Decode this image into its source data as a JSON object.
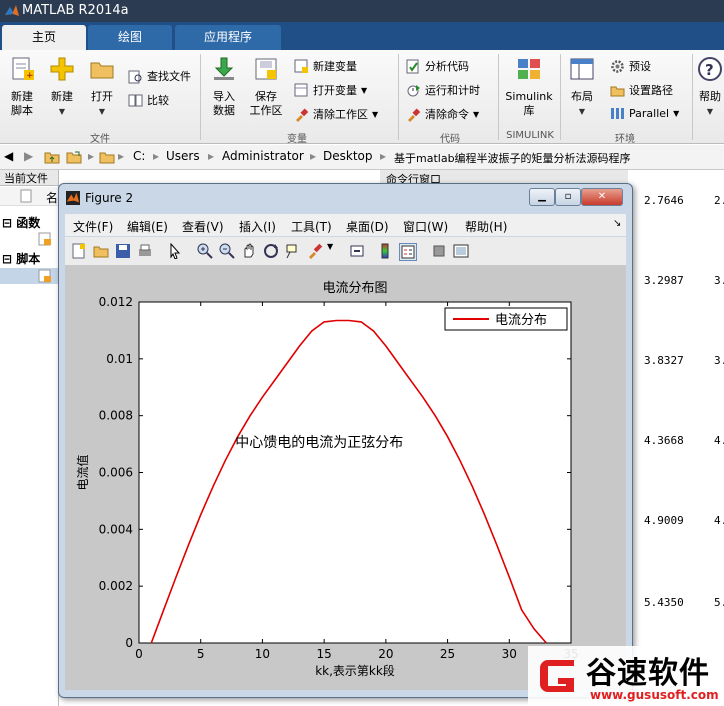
{
  "app": {
    "title": "MATLAB R2014a"
  },
  "tabs": [
    {
      "label": "主页"
    },
    {
      "label": "绘图"
    },
    {
      "label": "应用程序"
    }
  ],
  "ribbon": {
    "file": {
      "new_script": "新建\n脚本",
      "new": "新建",
      "open": "打开",
      "find_files": "查找文件",
      "compare": "比较",
      "group": "文件"
    },
    "variable": {
      "import": "导入\n数据",
      "save": "保存\n工作区",
      "new_var": "新建变量",
      "open_var": "打开变量",
      "clear_ws": "清除工作区",
      "group": "变量"
    },
    "code": {
      "analyze": "分析代码",
      "run_time": "运行和计时",
      "clear_cmd": "清除命令",
      "group": "代码"
    },
    "simulink": {
      "library": "Simulink\n库",
      "group": "SIMULINK"
    },
    "env": {
      "layout": "布局",
      "prefs": "预设",
      "set_path": "设置路径",
      "parallel": "Parallel",
      "group": "环境"
    },
    "help": {
      "label": "帮助"
    }
  },
  "address": {
    "parts": [
      "C:",
      "Users",
      "Administrator",
      "Desktop",
      "基于matlab编程半波振子的矩量分析法源码程序"
    ]
  },
  "panels": {
    "current_folder": "当前文件夹",
    "command_window": "命令行窗口",
    "functions": "函数",
    "scripts": "脚本",
    "name_col": "名"
  },
  "cmd_values": [
    {
      "a": "2.7646",
      "b": "2."
    },
    {
      "a": "3.2987",
      "b": "3."
    },
    {
      "a": "3.8327",
      "b": "3."
    },
    {
      "a": "4.3668",
      "b": "4."
    },
    {
      "a": "4.9009",
      "b": "4."
    },
    {
      "a": "5.4350",
      "b": "5."
    }
  ],
  "figure": {
    "title": "Figure 2",
    "menu": [
      "文件(F)",
      "编辑(E)",
      "查看(V)",
      "插入(I)",
      "工具(T)",
      "桌面(D)",
      "窗口(W)",
      "帮助(H)"
    ]
  },
  "chart_data": {
    "type": "line",
    "title": "电流分布图",
    "xlabel": "kk,表示第kk段",
    "ylabel": "电流值",
    "xlim": [
      0,
      35
    ],
    "ylim": [
      0,
      0.012
    ],
    "xticks": [
      "0",
      "5",
      "10",
      "15",
      "20",
      "25",
      "30",
      "35"
    ],
    "yticks": [
      "0",
      "0.002",
      "0.004",
      "0.006",
      "0.008",
      "0.01",
      "0.012"
    ],
    "annotation": "中心馈电的电流为正弦分布",
    "legend": {
      "location": "top-right"
    },
    "series": [
      {
        "name": "电流分布",
        "color": "#e00000",
        "x": [
          1,
          2,
          3,
          4,
          5,
          6,
          7,
          8,
          9,
          10,
          11,
          12,
          13,
          14,
          15,
          16,
          17,
          18,
          19,
          20,
          21,
          22,
          23,
          24,
          25,
          26,
          27,
          28,
          29,
          30,
          31,
          32,
          33
        ],
        "y": [
          0,
          0.00117,
          0.00232,
          0.00344,
          0.00451,
          0.00551,
          0.00643,
          0.00726,
          0.008,
          0.00865,
          0.00925,
          0.00985,
          0.01045,
          0.01098,
          0.0113,
          0.01135,
          0.01135,
          0.0113,
          0.01098,
          0.01045,
          0.00985,
          0.00925,
          0.00865,
          0.008,
          0.00726,
          0.00643,
          0.00551,
          0.00451,
          0.00344,
          0.00232,
          0.00117,
          0.0005,
          0
        ]
      }
    ]
  },
  "watermark": {
    "brand": "谷速软件",
    "url": "www.gususoft.com"
  },
  "colors": {
    "accent": "#1f4f86",
    "line": "#e00000"
  }
}
